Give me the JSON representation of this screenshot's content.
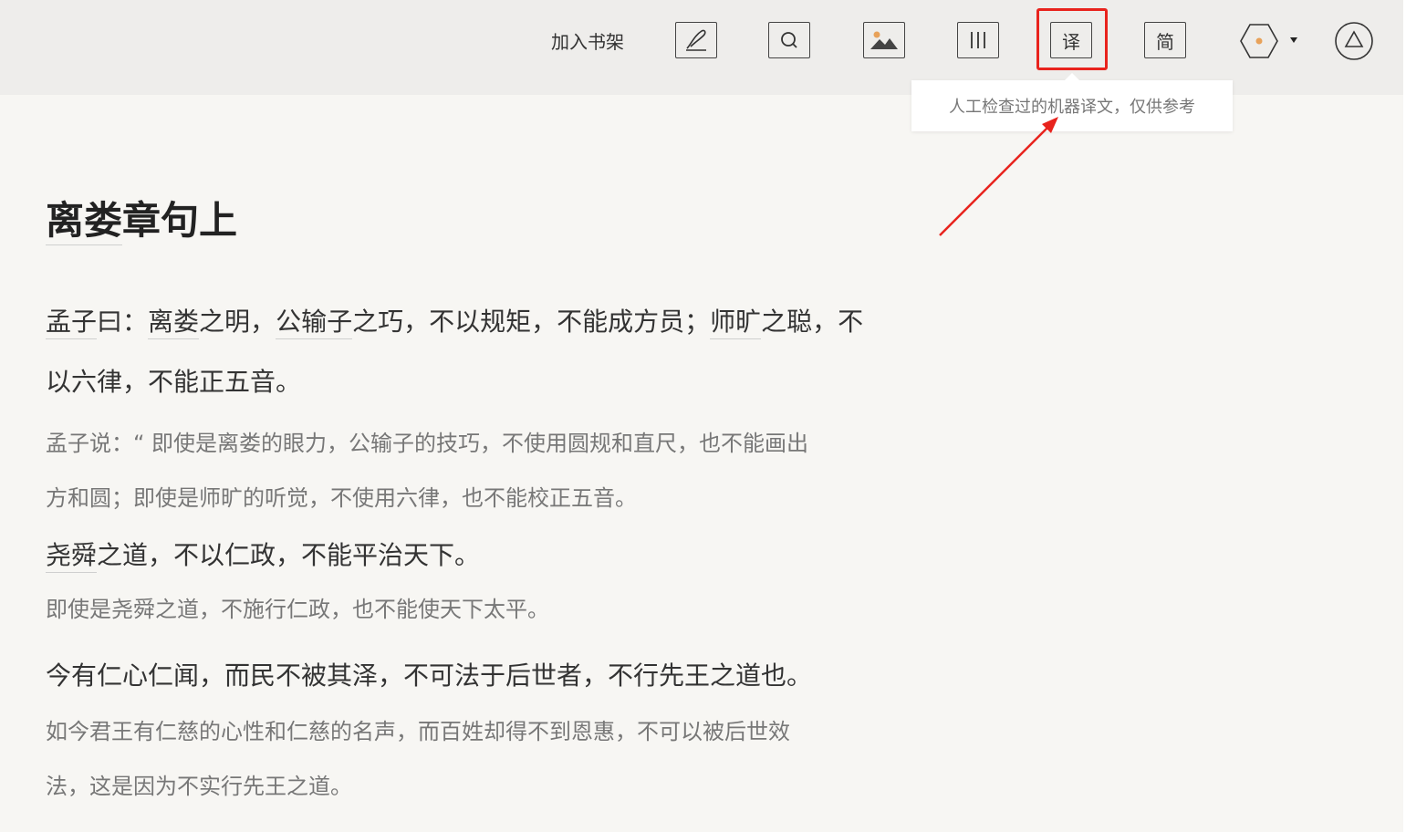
{
  "toolbar": {
    "add_to_shelf": "加入书架",
    "translate_label": "译",
    "simplified_label": "简",
    "icons": [
      "note-icon",
      "search-icon",
      "image-icon",
      "columns-icon",
      "translate-icon",
      "simplified-icon",
      "theme-icon",
      "upload-icon"
    ]
  },
  "tooltip": {
    "text": "人工检查过的机器译文，仅供参考"
  },
  "colors": {
    "highlight": "#e8231d",
    "theme_dot": "#e8a25a"
  },
  "article": {
    "title_underlined": "离娄",
    "title_rest": "章句上",
    "p1": {
      "orig_a": "孟子",
      "orig_b": "曰：",
      "orig_c": "离娄",
      "orig_d": "之明，",
      "orig_e": "公输子",
      "orig_f": "之巧，不以规矩，不能成方员；",
      "orig_g": "师旷",
      "orig_h": "之聪，不",
      "orig_line2": "以六律，不能正五音。",
      "trans_line1": "孟子说：“ 即使是离娄的眼力，公输子的技巧，不使用圆规和直尺，也不能画出",
      "trans_line2": "方和圆；即使是师旷的听觉，不使用六律，也不能校正五音。"
    },
    "p2": {
      "orig_a": "尧舜",
      "orig_b": "之道，不以仁政，不能平治天下。",
      "trans": "即使是尧舜之道，不施行仁政，也不能使天下太平。"
    },
    "p3": {
      "orig": "今有仁心仁闻，而民不被其泽，不可法于后世者，不行先王之道也。",
      "trans_line1": "如今君王有仁慈的心性和仁慈的名声，而百姓却得不到恩惠，不可以被后世效",
      "trans_line2": "法，这是因为不实行先王之道。"
    }
  }
}
